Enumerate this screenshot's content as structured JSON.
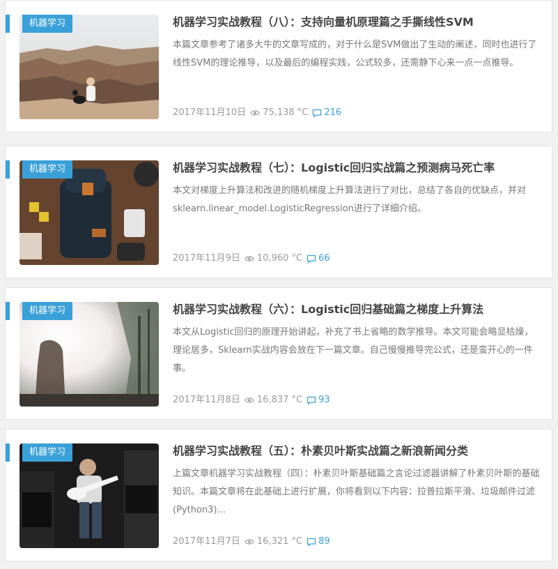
{
  "articles": [
    {
      "category": "机器学习",
      "title": "机器学习实战教程（八）：支持向量机原理篇之手撕线性SVM",
      "excerpt": "本篇文章参考了诸多大牛的文章写成的，对于什么是SVM做出了生动的阐述，同时也进行了线性SVM的理论推导，以及最后的编程实践，公式较多，还需静下心来一点一点推导。",
      "date": "2017年11月10日",
      "views": "75,138 °C",
      "comments": "216",
      "image": "canyon-with-person-and-dog"
    },
    {
      "category": "机器学习",
      "title": "机器学习实战教程（七）：Logistic回归实战篇之预测病马死亡率",
      "excerpt": "本文对梯度上升算法和改进的随机梯度上升算法进行了对比，总结了各自的优缺点，并对sklearn.linear_model.LogisticRegression进行了详细介绍。",
      "date": "2017年11月9日",
      "views": "10,960 °C",
      "comments": "66",
      "image": "backpack-flatlay"
    },
    {
      "category": "机器学习",
      "title": "机器学习实战教程（六）：Logistic回归基础篇之梯度上升算法",
      "excerpt": "本文从Logistic回归的原理开始讲起，补充了书上省略的数学推导。本文可能会略显枯燥，理论居多，Sklearn实战内容会放在下一篇文章。自己慢慢推导完公式，还是蛮开心的一件事。",
      "date": "2017年11月8日",
      "views": "16,837 °C",
      "comments": "93",
      "image": "sunlight-forest"
    },
    {
      "category": "机器学习",
      "title": "机器学习实战教程（五）：朴素贝叶斯实战篇之新浪新闻分类",
      "excerpt": "上篇文章机器学习实战教程（四）：朴素贝叶斯基础篇之言论过滤器讲解了朴素贝叶斯的基础知识。本篇文章将在此基础上进行扩展，你将看到以下内容：拉普拉斯平滑、垃圾邮件过滤(Python3)...",
      "date": "2017年11月7日",
      "views": "16,321 °C",
      "comments": "89",
      "image": "guitarist-with-amps"
    }
  ],
  "icons": {
    "views": "eye-icon",
    "comments": "comment-icon"
  },
  "colors": {
    "accent": "#3aa0d8",
    "title": "#444444",
    "text": "#777777",
    "meta": "#999999"
  }
}
